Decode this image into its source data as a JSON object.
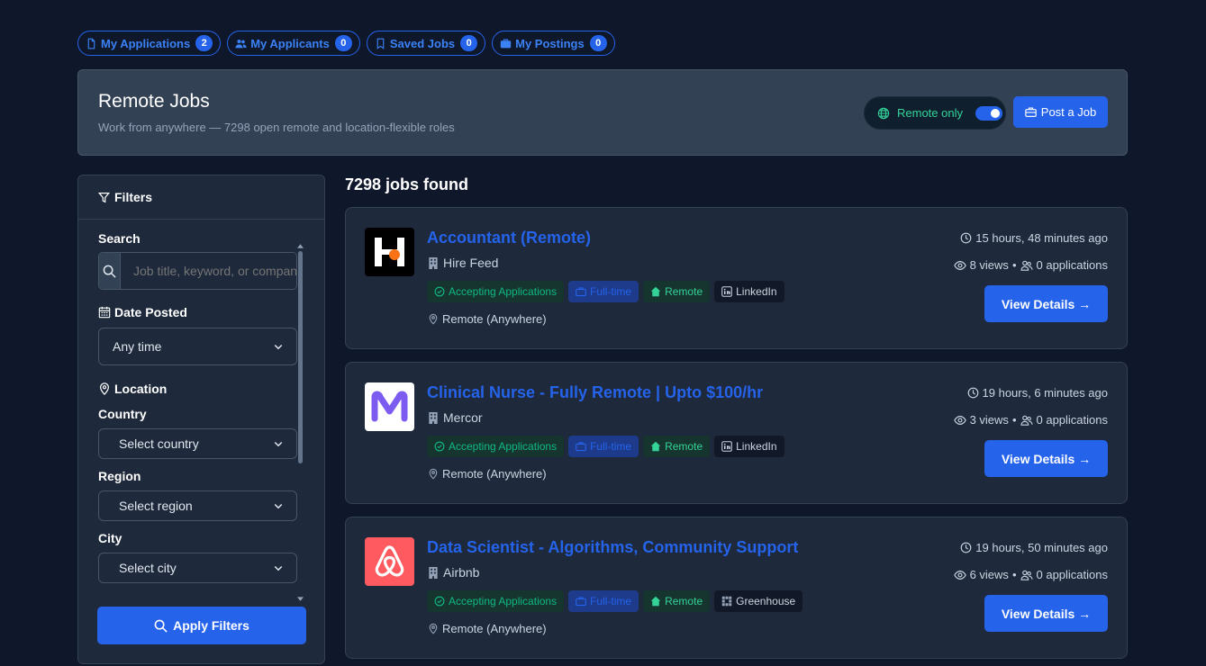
{
  "tabs": [
    {
      "label": "My Applications",
      "count": "2",
      "icon": "file-icon"
    },
    {
      "label": "My Applicants",
      "count": "0",
      "icon": "users-icon"
    },
    {
      "label": "Saved Jobs",
      "count": "0",
      "icon": "bookmark-icon"
    },
    {
      "label": "My Postings",
      "count": "0",
      "icon": "briefcase-icon"
    }
  ],
  "hero": {
    "title": "Remote Jobs",
    "subtitle": "Work from anywhere — 7298 open remote and location-flexible roles",
    "remote_only_label": "Remote only",
    "remote_only_on": true,
    "post_job_label": "Post a Job"
  },
  "filters": {
    "heading": "Filters",
    "search_label": "Search",
    "search_placeholder": "Job title, keyword, or company",
    "date_label": "Date Posted",
    "date_value": "Any time",
    "location_label": "Location",
    "country_label": "Country",
    "country_value": "Select country",
    "region_label": "Region",
    "region_value": "Select region",
    "city_label": "City",
    "city_value": "Select city",
    "apply_label": "Apply Filters"
  },
  "results": {
    "count_text": "7298 jobs found",
    "jobs": [
      {
        "title": "Accountant (Remote)",
        "company": "Hire Feed",
        "status": "Accepting Applications",
        "type": "Full-time",
        "mode": "Remote",
        "source": "LinkedIn",
        "location": "Remote (Anywhere)",
        "posted": "15 hours, 48 minutes ago",
        "views": "8 views",
        "applications": "0 applications",
        "view_label": "View Details →"
      },
      {
        "title": "Clinical Nurse - Fully Remote | Upto $100/hr",
        "company": "Mercor",
        "status": "Accepting Applications",
        "type": "Full-time",
        "mode": "Remote",
        "source": "LinkedIn",
        "location": "Remote (Anywhere)",
        "posted": "19 hours, 6 minutes ago",
        "views": "3 views",
        "applications": "0 applications",
        "view_label": "View Details →"
      },
      {
        "title": "Data Scientist - Algorithms, Community Support",
        "company": "Airbnb",
        "status": "Accepting Applications",
        "type": "Full-time",
        "mode": "Remote",
        "source": "Greenhouse",
        "location": "Remote (Anywhere)",
        "posted": "19 hours, 50 minutes ago",
        "views": "6 views",
        "applications": "0 applications",
        "view_label": "View Details →"
      }
    ]
  },
  "colors": {
    "background": "#0f172a",
    "card": "#1e293b",
    "accent": "#2563eb",
    "success": "#10b981"
  }
}
